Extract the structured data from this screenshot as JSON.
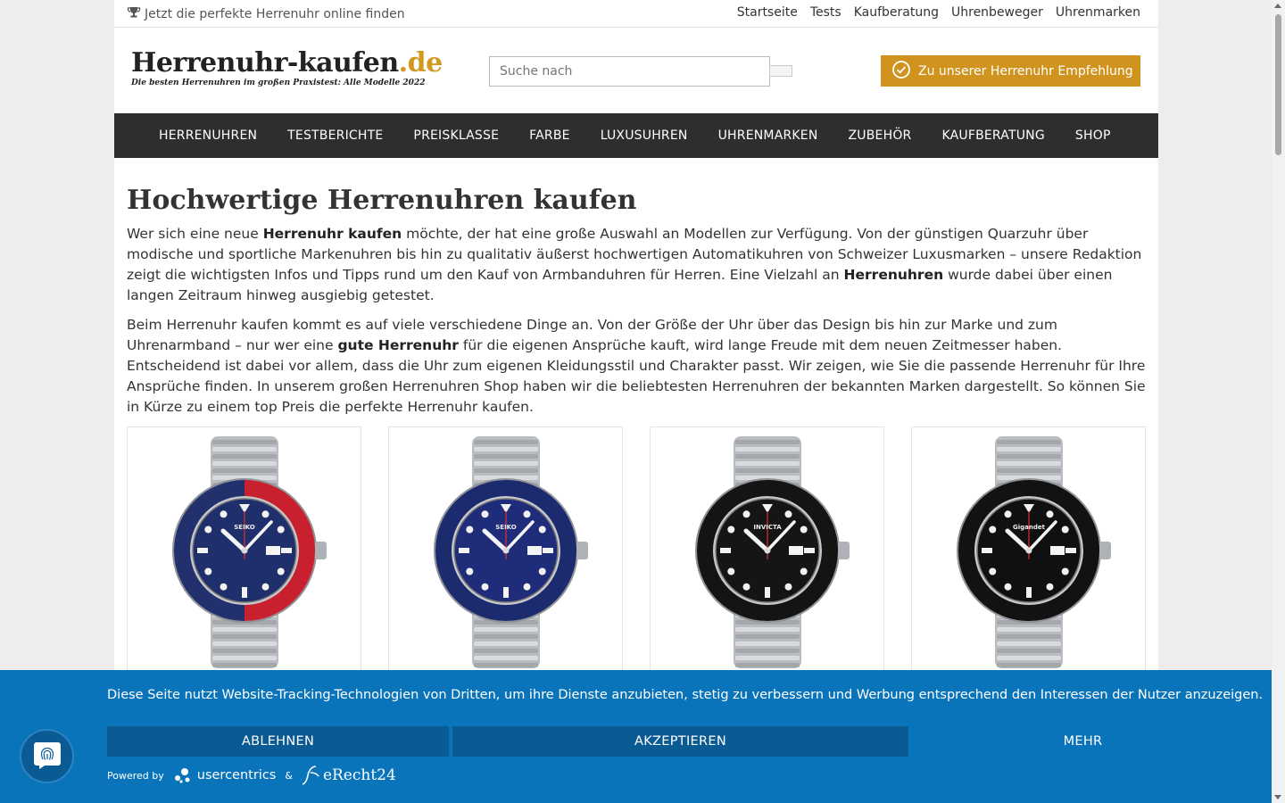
{
  "topbar": {
    "tagline": "Jetzt die perfekte Herrenuhr online finden",
    "tagline_icon": "trophy-icon",
    "links": [
      "Startseite",
      "Tests",
      "Kaufberatung",
      "Uhrenbeweger",
      "Uhrenmarken"
    ]
  },
  "header": {
    "logo_main": "Herrenuhr-kaufen",
    "logo_tld": ".de",
    "logo_sub": "Die besten Herrenuhren im großen Praxistest: Alle Modelle 2022",
    "search_placeholder": "Suche nach",
    "cta_label": "Zu unserer Herrenuhr Empfehlung",
    "cta_icon": "check-circle-icon",
    "accent_color": "#d0941e"
  },
  "nav": {
    "items": [
      "HERRENUHREN",
      "TESTBERICHTE",
      "PREISKLASSE",
      "FARBE",
      "LUXUSUHREN",
      "UHRENMARKEN",
      "ZUBEHÖR",
      "KAUFBERATUNG",
      "SHOP"
    ]
  },
  "main": {
    "title": "Hochwertige Herrenuhren kaufen",
    "p1": {
      "a": "Wer sich eine neue ",
      "b": "Herrenuhr kaufen",
      "c": " möchte, der hat eine große Auswahl an Modellen zur Verfügung. Von der günstigen Quarzuhr über modische und sportliche Markenuhren bis hin zu qualitativ äußerst hochwertigen Automatikuhren von Schweizer Luxusmarken – unsere Redaktion zeigt die wichtigsten Infos und Tipps rund um den Kauf von Armbanduhren für Herren. Eine Vielzahl an ",
      "d": "Herrenuhren",
      "e": " wurde dabei über einen langen Zeitraum hinweg ausgiebig getestet."
    },
    "p2": {
      "a": "Beim Herrenuhr kaufen kommt es auf viele verschiedene Dinge an. Von der Größe der Uhr über das Design bis hin zur Marke und zum Uhrenarmband – nur wer eine ",
      "b": "gute Herrenuhr",
      "c": " für die eigenen Ansprüche kauft, wird lange Freude mit dem neuen Zeitmesser haben. Entscheidend ist dabei vor allem, dass die Uhr zum eigenen Kleidungsstil und Charakter passt. Wir zeigen, wie Sie die passende Herrenuhr für Ihre Ansprüche finden. In unserem großen Herrenuhren Shop haben wir die beliebtesten Herrenuhren der bekannten Marken dargestellt. So können Sie in Kürze zu einem top Preis die perfekte Herrenuhr kaufen."
    },
    "products": [
      {
        "brand": "SEIKO",
        "dial": "#1f2f6b",
        "bezel_a": "#22306e",
        "bezel_b": "#c8202f"
      },
      {
        "brand": "SEIKO",
        "dial": "#1e2c7a",
        "bezel_a": "#1c2a6e",
        "bezel_b": "#1c2a6e"
      },
      {
        "brand": "INVICTA",
        "dial": "#151515",
        "bezel_a": "#141414",
        "bezel_b": "#141414"
      },
      {
        "brand": "Gigandet",
        "dial": "#101010",
        "bezel_a": "#121212",
        "bezel_b": "#121212"
      }
    ]
  },
  "consent": {
    "message": "Diese Seite nutzt Website-Tracking-Technologien von Dritten, um ihre Dienste anzubieten, stetig zu verbessern und Werbung entsprechend den Interessen der Nutzer anzuzeigen.",
    "decline": "ABLEHNEN",
    "accept": "AKZEPTIEREN",
    "more": "MEHR",
    "powered_by": "Powered by",
    "provider": "usercentrics",
    "amp": "&",
    "partner": "eRecht24",
    "banner_color": "#0a74bb",
    "fingerprint_icon": "fingerprint-icon"
  }
}
